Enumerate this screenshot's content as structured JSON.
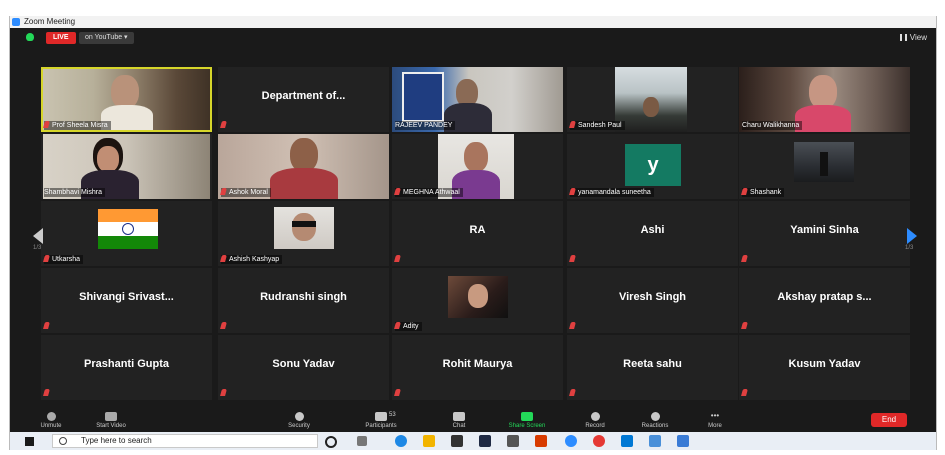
{
  "window": {
    "title": "Zoom Meeting"
  },
  "topbar": {
    "live_label": "LIVE",
    "stream_label": "on YouTube ▾",
    "view_label": "View"
  },
  "gallery": {
    "page_left": "1/3",
    "page_right": "1/3",
    "tiles": [
      {
        "label": "Prof Sheela Misra",
        "center": "",
        "active": true
      },
      {
        "label": "",
        "center": "Department of..."
      },
      {
        "label": "RAJEEV PANDEY",
        "center": ""
      },
      {
        "label": "Sandesh Paul",
        "center": ""
      },
      {
        "label": "Charu Walikhanna",
        "center": ""
      },
      {
        "label": "Shambhavi Mishra",
        "center": ""
      },
      {
        "label": "Ashok Moral",
        "center": ""
      },
      {
        "label": "MEGHNA Athwaal",
        "center": ""
      },
      {
        "label": "yanamandala suneetha",
        "center": "",
        "avatar_letter": "y"
      },
      {
        "label": "Shashank",
        "center": ""
      },
      {
        "label": "Utkarsha",
        "center": ""
      },
      {
        "label": "Ashish Kashyap",
        "center": ""
      },
      {
        "label": "",
        "center": "RA"
      },
      {
        "label": "",
        "center": "Ashi"
      },
      {
        "label": "",
        "center": "Yamini Sinha"
      },
      {
        "label": "",
        "center": "Shivangi  Srivast..."
      },
      {
        "label": "",
        "center": "Rudranshi singh"
      },
      {
        "label": "Adity",
        "center": ""
      },
      {
        "label": "",
        "center": "Viresh Singh"
      },
      {
        "label": "",
        "center": "Akshay  pratap  s..."
      },
      {
        "label": "",
        "center": "Prashanti Gupta"
      },
      {
        "label": "",
        "center": "Sonu Yadav"
      },
      {
        "label": "",
        "center": "Rohit Maurya"
      },
      {
        "label": "",
        "center": "Reeta sahu"
      },
      {
        "label": "",
        "center": "Kusum Yadav"
      }
    ]
  },
  "toolbar": {
    "unmute": "Unmute",
    "start_video": "Start Video",
    "security": "Security",
    "participants": "Participants",
    "participants_count": "53",
    "chat": "Chat",
    "share_screen": "Share Screen",
    "record": "Record",
    "reactions": "Reactions",
    "more": "More",
    "end": "End"
  },
  "taskbar": {
    "search_placeholder": "Type here to search"
  },
  "colors": {
    "live_red": "#e02828",
    "zoom_blue": "#2d8cff",
    "share_green": "#23d959",
    "active_speaker": "#d6d62a",
    "tile_bg": "#222222"
  }
}
